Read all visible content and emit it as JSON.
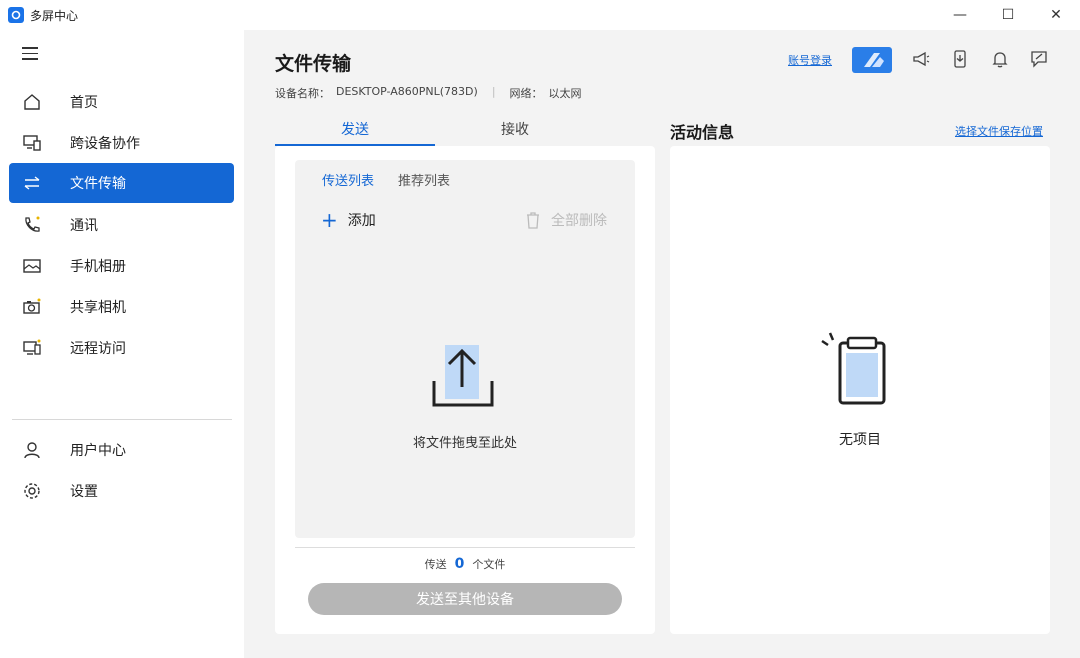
{
  "window": {
    "title": "多屏中心",
    "controls": {
      "minimize": "—",
      "maximize": "☐",
      "close": "✕"
    }
  },
  "sidebar": {
    "items": [
      {
        "label": "首页",
        "icon": "home-icon"
      },
      {
        "label": "跨设备协作",
        "icon": "devices-icon"
      },
      {
        "label": "文件传输",
        "icon": "transfer-icon",
        "active": true
      },
      {
        "label": "通讯",
        "icon": "phone-icon"
      },
      {
        "label": "手机相册",
        "icon": "gallery-icon"
      },
      {
        "label": "共享相机",
        "icon": "camera-icon"
      },
      {
        "label": "远程访问",
        "icon": "remote-icon"
      },
      {
        "label": "用户中心",
        "icon": "user-icon"
      },
      {
        "label": "设置",
        "icon": "gear-icon"
      }
    ]
  },
  "header": {
    "title": "文件传输",
    "device_label": "设备名称：",
    "device_name": "DESKTOP-A860PNL(783D)",
    "network_label": "网络：",
    "network_value": "以太网",
    "login_link": "账号登录"
  },
  "tabs": {
    "send": "发送",
    "receive": "接收"
  },
  "send_panel": {
    "subtab_send_list": "传送列表",
    "subtab_recommend_list": "推荐列表",
    "add_label": "添加",
    "delete_all_label": "全部删除",
    "drop_hint": "将文件拖曳至此处",
    "count_prefix": "传送",
    "count_value": "0",
    "count_suffix": "个文件",
    "send_button": "发送至其他设备"
  },
  "activity": {
    "title": "活动信息",
    "save_location_link": "选择文件保存位置",
    "empty_text": "无项目"
  },
  "colors": {
    "accent": "#1467d4",
    "disabled_button": "#b6b6b6"
  }
}
